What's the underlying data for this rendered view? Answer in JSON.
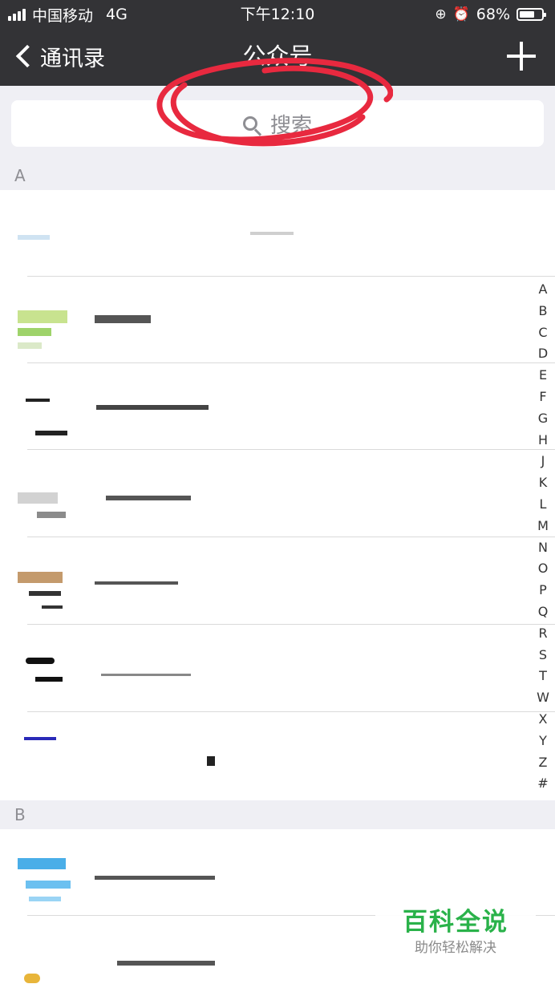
{
  "status_bar": {
    "carrier": "中国移动",
    "network": "4G",
    "time": "下午12:10",
    "battery": "68%",
    "battery_level": 0.68,
    "icons": [
      "signal-icon",
      "orientation-lock-icon",
      "alarm-icon",
      "battery-icon"
    ]
  },
  "nav": {
    "back_label": "通讯录",
    "title": "公众号",
    "add_icon": "plus-icon"
  },
  "search": {
    "placeholder": "搜索",
    "icon": "search-icon"
  },
  "colors": {
    "nav_bg": "#333336",
    "section_bg": "#efeff4",
    "annotation": "#e8293f",
    "watermark": "#2ab24a"
  },
  "sections": [
    {
      "letter": "A",
      "rows": 7
    },
    {
      "letter": "B",
      "rows": 2
    }
  ],
  "index_letters": [
    "A",
    "B",
    "C",
    "D",
    "E",
    "F",
    "G",
    "H",
    "J",
    "K",
    "L",
    "M",
    "N",
    "O",
    "P",
    "Q",
    "R",
    "S",
    "T",
    "W",
    "X",
    "Y",
    "Z",
    "#"
  ],
  "watermark": {
    "main": "百科全说",
    "sub": "助你轻松解决"
  }
}
